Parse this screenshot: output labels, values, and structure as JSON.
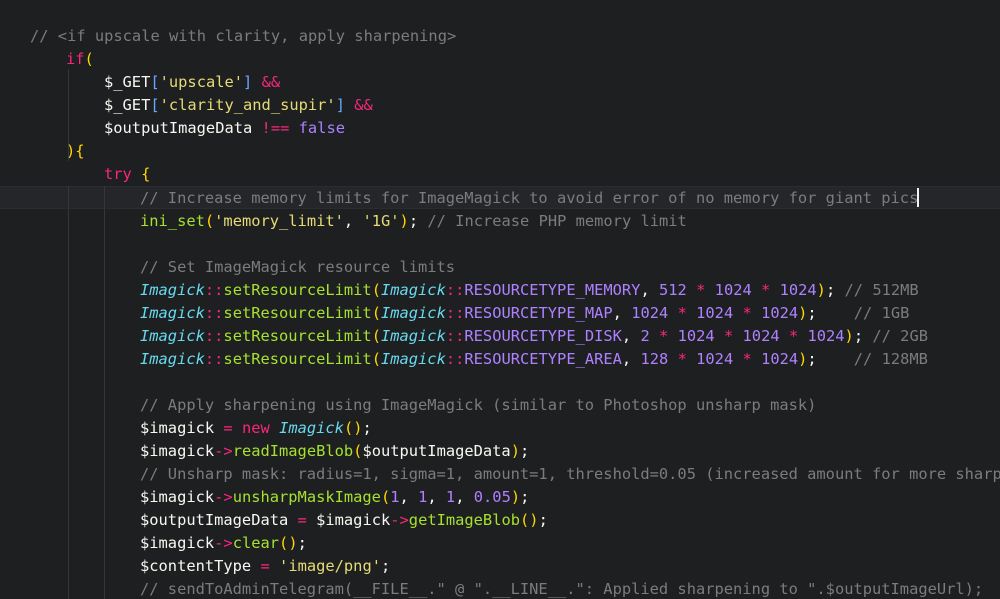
{
  "editor": {
    "language": "php",
    "theme_colors": {
      "background": "#1e1f21",
      "comment": "#7c7c7c",
      "keyword": "#f7287b",
      "string": "#e6db74",
      "number": "#ae81ff",
      "function": "#a6e22e",
      "class": "#66d9ef"
    },
    "lines": [
      "// <if upscale with clarity, apply sharpening>",
      "if(",
      "$_GET['upscale'] &&",
      "$_GET['clarity_and_supir'] &&",
      "$outputImageData !== false",
      "){",
      "try {",
      "// Increase memory limits for ImageMagick to avoid error of no memory for giant pics",
      "ini_set('memory_limit', '1G'); // Increase PHP memory limit",
      "",
      "// Set ImageMagick resource limits",
      "Imagick::setResourceLimit(Imagick::RESOURCETYPE_MEMORY, 512 * 1024 * 1024); // 512MB",
      "Imagick::setResourceLimit(Imagick::RESOURCETYPE_MAP, 1024 * 1024 * 1024);    // 1GB",
      "Imagick::setResourceLimit(Imagick::RESOURCETYPE_DISK, 2 * 1024 * 1024 * 1024); // 2GB",
      "Imagick::setResourceLimit(Imagick::RESOURCETYPE_AREA, 128 * 1024 * 1024);    // 128MB",
      "",
      "// Apply sharpening using ImageMagick (similar to Photoshop unsharp mask)",
      "$imagick = new Imagick();",
      "$imagick->readImageBlob($outputImageData);",
      "// Unsharp mask: radius=1, sigma=1, amount=1, threshold=0.05 (increased amount for more sharp",
      "$imagick->unsharpMaskImage(1, 1, 1, 0.05);",
      "$outputImageData = $imagick->getImageBlob();",
      "$imagick->clear();",
      "$contentType = 'image/png';",
      "// sendToAdminTelegram(__FILE__.\" @ \".__LINE__.\": Applied sharpening to \".$outputImageUrl);"
    ]
  }
}
